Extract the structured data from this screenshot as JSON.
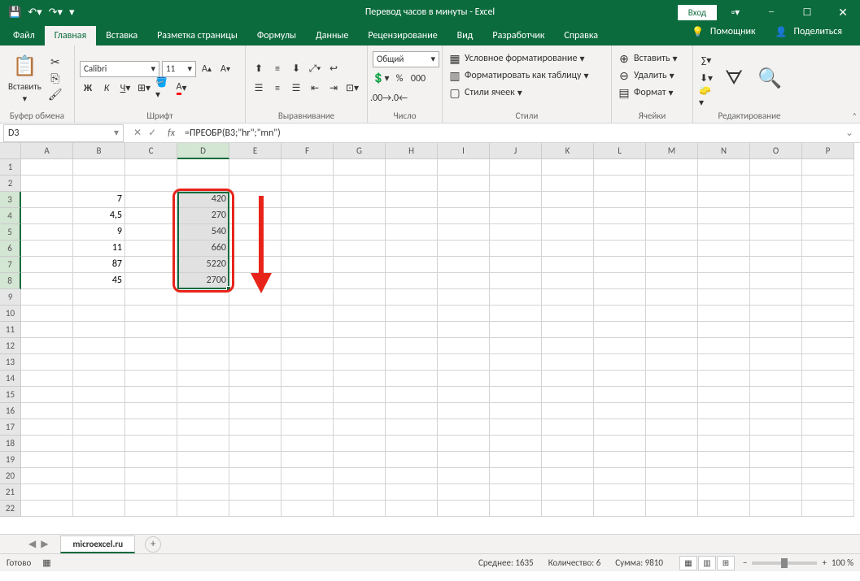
{
  "title": "Перевод часов в минуты  -  Excel",
  "login": "Вход",
  "tabs": {
    "file": "Файл",
    "home": "Главная",
    "insert": "Вставка",
    "layout": "Разметка страницы",
    "formulas": "Формулы",
    "data": "Данные",
    "review": "Рецензирование",
    "view": "Вид",
    "dev": "Разработчик",
    "help": "Справка",
    "tell": "Помощник",
    "share": "Поделиться"
  },
  "groups": {
    "clipboard": "Буфер обмена",
    "font": "Шрифт",
    "align": "Выравнивание",
    "number": "Число",
    "styles": "Стили",
    "cells": "Ячейки",
    "editing": "Редактирование"
  },
  "font": {
    "name": "Calibri",
    "size": "11"
  },
  "numberFormat": "Общий",
  "paste": "Вставить",
  "styles": {
    "cond": "Условное форматирование",
    "table": "Форматировать как таблицу",
    "cell": "Стили ячеек"
  },
  "cells": {
    "insert": "Вставить",
    "delete": "Удалить",
    "format": "Формат"
  },
  "namebox": "D3",
  "formula": "=ПРЕОБР(B3;\"hr\";\"mn\")",
  "cols": [
    "A",
    "B",
    "C",
    "D",
    "E",
    "F",
    "G",
    "H",
    "I",
    "J",
    "K",
    "L",
    "M",
    "N",
    "O",
    "P"
  ],
  "colB": [
    "7",
    "4,5",
    "9",
    "11",
    "87",
    "45"
  ],
  "colD": [
    "420",
    "270",
    "540",
    "660",
    "5220",
    "2700"
  ],
  "sheet": "microexcel.ru",
  "status": {
    "ready": "Готово",
    "avg": "Среднее: 1635",
    "count": "Количество: 6",
    "sum": "Сумма: 9810",
    "zoom": "100 %"
  }
}
